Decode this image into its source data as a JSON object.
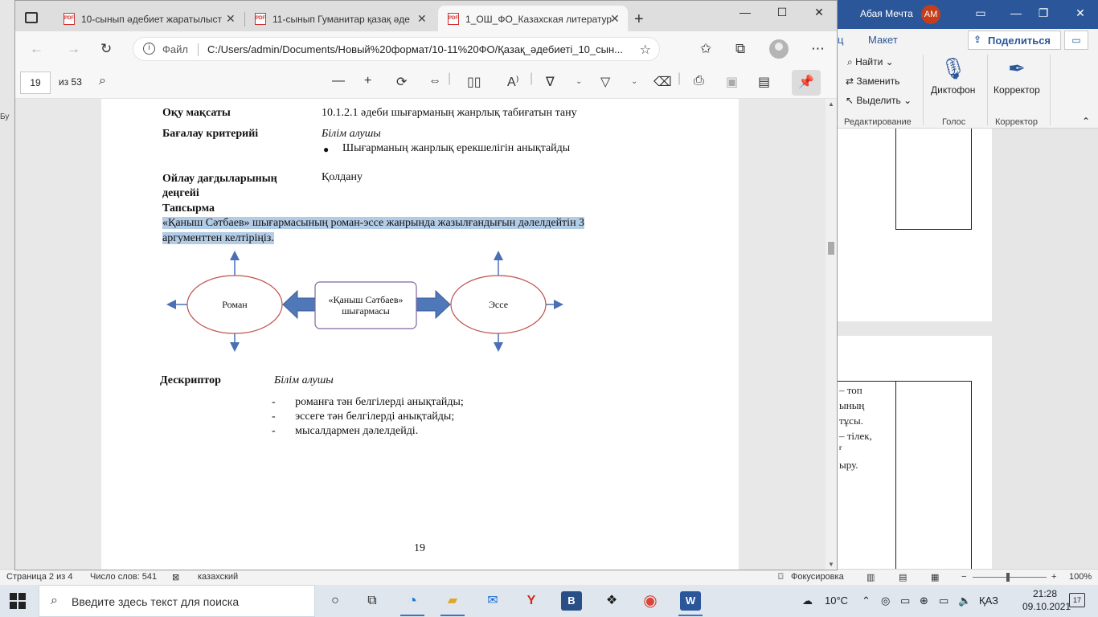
{
  "word": {
    "user_name": "Абая Мечта",
    "user_initials": "AM",
    "tabs": [
      "ц",
      "Макет"
    ],
    "share_label": "Поделиться",
    "ribbon": {
      "find": "Найти",
      "replace": "Заменить",
      "select": "Выделить",
      "dictation": "Диктофон",
      "editor": "Корректор",
      "group_editing": "Редактирование",
      "group_voice": "Голос",
      "group_editor": "Корректор"
    },
    "left_fragment": "Бу",
    "page_fragments": [
      "– топ",
      "ының",
      "тұсы.",
      "– тілек,",
      "ғ",
      "ыру."
    ],
    "status": {
      "page": "Страница 2 из 4",
      "words": "Число слов: 541",
      "language": "казахский",
      "focus": "Фокусировка",
      "zoom": "100%"
    }
  },
  "browser": {
    "tabs": [
      {
        "title": "10-сынып әдебиет жаратылыст"
      },
      {
        "title": "11-сынып Гуманитар қазақ әде"
      },
      {
        "title": "1_ОШ_ФО_Казахская литератур"
      }
    ],
    "scheme": "Файл",
    "url": "C:/Users/admin/Documents/Новый%20формат/10-11%20ФО/Қазақ_әдебиеті_10_сын..."
  },
  "pdf_toolbar": {
    "page_current": "19",
    "page_total": "из 53"
  },
  "document": {
    "label_goal": "Оқу мақсаты",
    "goal": "10.1.2.1 әдеби шығарманың жанрлық табиғатын тану",
    "label_criteria": "Бағалау критерийі",
    "criteria_intro": "Білім алушы",
    "criteria_item": "Шығарманың жанрлық ерекшелігін анықтайды",
    "label_thinking_1": "Ойлау дағдыларының",
    "label_thinking_2": "деңгейі",
    "thinking": "Қолдану",
    "label_task": "Тапсырма",
    "task_line1": "«Қаныш Сәтбаев» шығармасының роман-эссе жанрында жазылғандығын дәлелдейтін 3",
    "task_line2": "аргументтен келтіріңіз.",
    "diagram": {
      "left": "Роман",
      "center_line1": "«Қаныш Сәтбаев»",
      "center_line2": "шығармасы",
      "right": "Эссе"
    },
    "label_descriptor": "Дескриптор",
    "descriptor_intro": "Білім алушы",
    "descriptor_items": [
      "романға тән белгілерді анықтайды;",
      "эссеге тән белгілерді анықтайды;",
      "мысалдармен дәлелдейді."
    ],
    "page_number": "19"
  },
  "taskbar": {
    "search_placeholder": "Введите здесь текст для поиска",
    "temperature": "10°C",
    "language": "ҚАЗ",
    "time": "21:28",
    "date": "09.10.2021",
    "notifications": "17"
  }
}
